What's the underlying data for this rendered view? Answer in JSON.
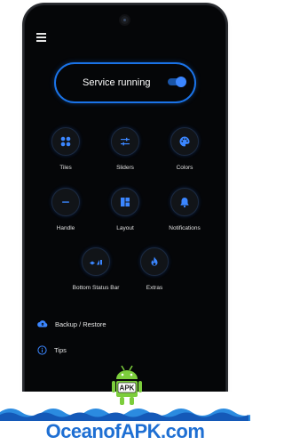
{
  "service": {
    "label": "Service running",
    "enabled": true
  },
  "tiles": [
    {
      "label": "Tiles",
      "icon": "tiles-icon"
    },
    {
      "label": "Sliders",
      "icon": "sliders-icon"
    },
    {
      "label": "Colors",
      "icon": "palette-icon"
    },
    {
      "label": "Handle",
      "icon": "handle-icon"
    },
    {
      "label": "Layout",
      "icon": "layout-icon"
    },
    {
      "label": "Notifications",
      "icon": "bell-icon"
    },
    {
      "label": "Bottom Status Bar",
      "icon": "status-bar-icon"
    },
    {
      "label": "Extras",
      "icon": "flame-icon"
    }
  ],
  "list": [
    {
      "label": "Backup / Restore",
      "icon": "cloud-upload-icon"
    },
    {
      "label": "Tips",
      "icon": "info-icon"
    }
  ],
  "watermark": {
    "text": "OceanofAPK.com",
    "badge": "APK"
  },
  "colors": {
    "accent": "#1a73e8",
    "icon": "#3b86ff",
    "background": "#050608"
  }
}
